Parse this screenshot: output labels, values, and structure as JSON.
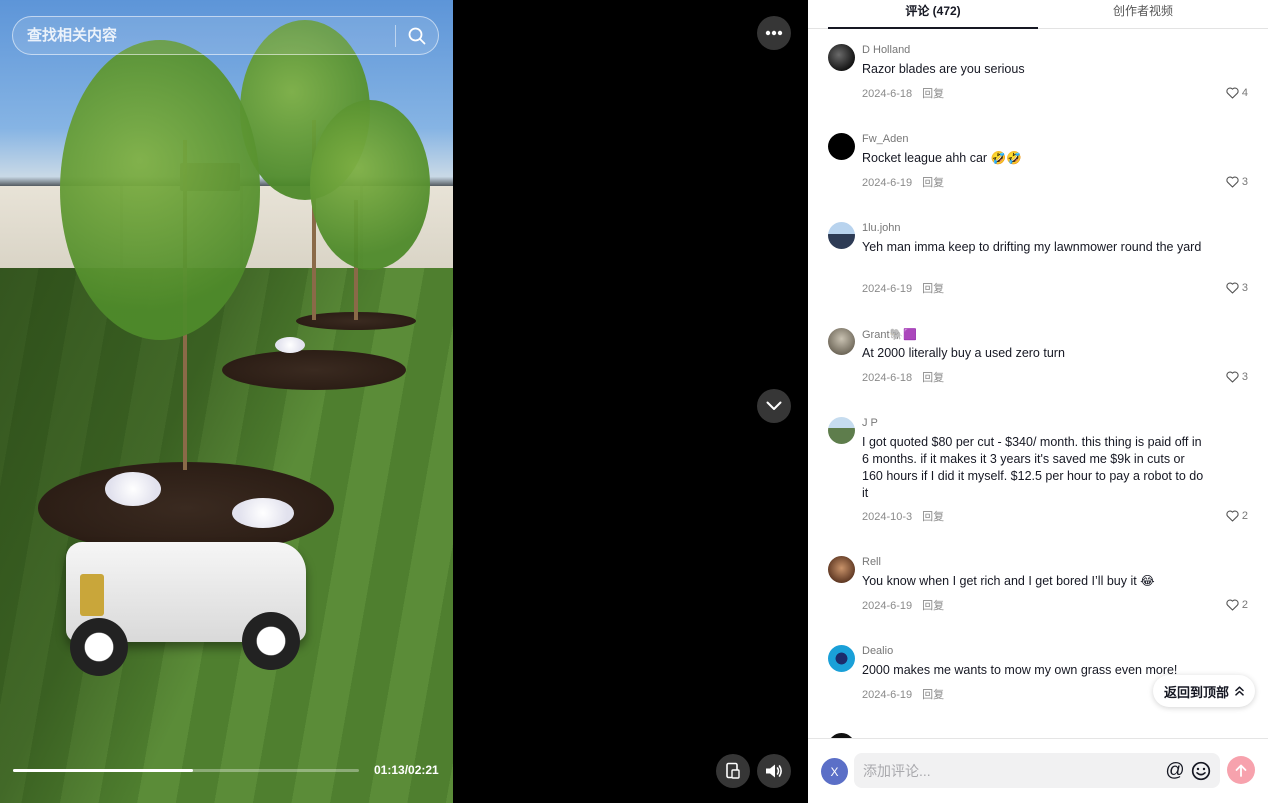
{
  "search": {
    "placeholder": "查找相关内容",
    "icon": "search-icon"
  },
  "player": {
    "current_time": "01:13",
    "duration": "02:21",
    "time_display": "01:13/02:21",
    "progress_fraction": 0.52,
    "more_icon": "more-dots-icon",
    "collapse_icon": "chevron-down-icon",
    "pip_icon": "picture-in-picture-icon",
    "volume_icon": "volume-icon"
  },
  "tabs": [
    {
      "label": "评论 (472)",
      "active": true
    },
    {
      "label": "创作者视频",
      "active": false
    }
  ],
  "comments": [
    {
      "user": "D Holland",
      "text": "Razor blades are you serious",
      "date": "2024-6-18",
      "reply": "回复",
      "likes": "4",
      "avatar_color": "#3a3a3a"
    },
    {
      "user": "Fw_Aden",
      "text": "Rocket league ahh car 🤣🤣",
      "date": "2024-6-19",
      "reply": "回复",
      "likes": "3",
      "avatar_color": "#000000"
    },
    {
      "user": "1lu.john",
      "text": "Yeh man imma keep to drifting my lawnmower round the yard",
      "date": "2024-6-19",
      "reply": "回复",
      "likes": "3",
      "avatar_color": "#6b8fb8"
    },
    {
      "user": "Grant🐘🟪",
      "text": "At 2000 literally buy a used zero turn",
      "date": "2024-6-18",
      "reply": "回复",
      "likes": "3",
      "avatar_color": "#8f8778"
    },
    {
      "user": "J P",
      "text": "I got quoted $80 per cut - $340/ month. this thing is paid off in 6 months. if it makes it 3 years it's saved me $9k in cuts or 160 hours if I did it myself. $12.5 per hour to pay a robot to do it",
      "date": "2024-10-3",
      "reply": "回复",
      "likes": "2",
      "avatar_color": "#7d9a6a"
    },
    {
      "user": "Rell",
      "text": "You know when I get rich and I get bored I’ll buy it 😂",
      "date": "2024-6-19",
      "reply": "回复",
      "likes": "2",
      "avatar_color": "#8a5a3c"
    },
    {
      "user": "Dealio",
      "text": "2000 makes me wants to mow my own grass even more!",
      "date": "2024-6-19",
      "reply": "回复",
      "likes": "",
      "avatar_color": "#1aa0d8"
    }
  ],
  "back_to_top": {
    "label": "返回到顶部",
    "icon": "double-chevron-up-icon"
  },
  "compose": {
    "avatar_letter": "X",
    "placeholder": "添加评论...",
    "mention_icon": "@",
    "emoji_icon": "emoji-icon",
    "send_icon": "arrow-up-icon"
  }
}
